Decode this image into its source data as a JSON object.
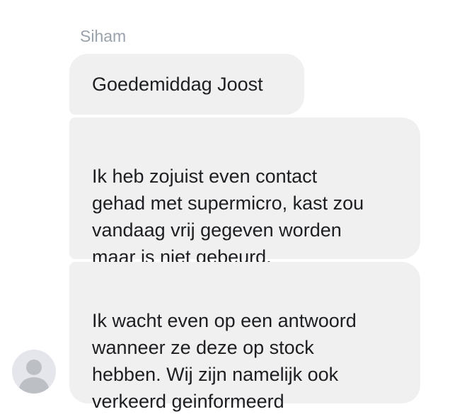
{
  "conversation": {
    "sender_name": "Siham",
    "avatar_icon": "default-user-avatar-icon",
    "messages": [
      {
        "text": "Goedemiddag Joost"
      },
      {
        "text": "Ik heb zojuist even contact\ngehad met supermicro, kast zou\nvandaag vrij gegeven worden\nmaar is niet gebeurd."
      },
      {
        "text": "Ik wacht even op een antwoord\nwanneer ze deze op stock\nhebben. Wij zijn namelijk ook\nverkeerd geinformeerd"
      }
    ]
  },
  "colors": {
    "bubble_background": "#f0f0f0",
    "sender_name": "#9aa2ab",
    "message_text": "#1c1e21",
    "avatar_background": "#e4e6eb",
    "avatar_silhouette": "#bcc0c4"
  }
}
